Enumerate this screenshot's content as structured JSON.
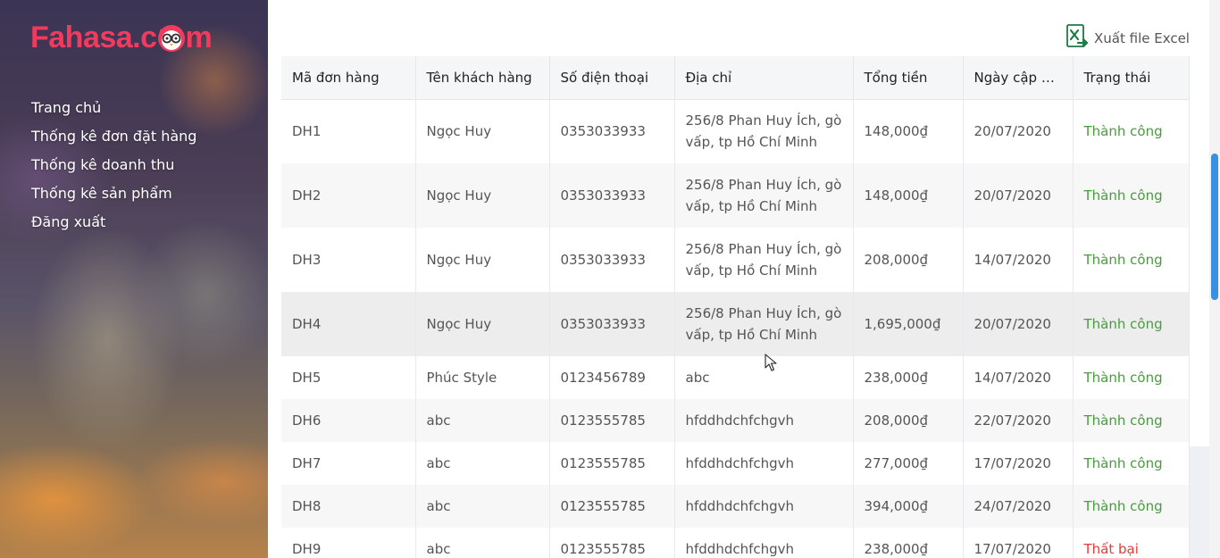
{
  "brand": {
    "logo_pre": "Fahasa.c",
    "logo_post": "m",
    "accent": "#f23a5e"
  },
  "nav": [
    {
      "label": "Trang chủ"
    },
    {
      "label": "Thống kê đơn đặt hàng"
    },
    {
      "label": "Thống kê doanh thu"
    },
    {
      "label": "Thống kê sản phẩm"
    },
    {
      "label": "Đăng xuất"
    }
  ],
  "export": {
    "label": "Xuất file Excel",
    "icon": "excel-icon"
  },
  "table": {
    "headers": [
      "Mã đơn hàng",
      "Tên khách hàng",
      "Số điện thoại",
      "Địa chỉ",
      "Tổng tiền",
      "Ngày cập n...",
      "Trạng thái"
    ],
    "rows": [
      {
        "id": "DH1",
        "name": "Ngọc Huy",
        "phone": "0353033933",
        "address": "256/8 Phan Huy Ích, gò vấp, tp Hồ Chí Minh",
        "total": "148,000₫",
        "date": "20/07/2020",
        "status": "Thành công"
      },
      {
        "id": "DH2",
        "name": "Ngọc Huy",
        "phone": "0353033933",
        "address": "256/8 Phan Huy Ích, gò vấp, tp Hồ Chí Minh",
        "total": "148,000₫",
        "date": "20/07/2020",
        "status": "Thành công"
      },
      {
        "id": "DH3",
        "name": "Ngọc Huy",
        "phone": "0353033933",
        "address": "256/8 Phan Huy Ích, gò vấp, tp Hồ Chí Minh",
        "total": "208,000₫",
        "date": "14/07/2020",
        "status": "Thành công"
      },
      {
        "id": "DH4",
        "name": "Ngọc Huy",
        "phone": "0353033933",
        "address": "256/8 Phan Huy Ích, gò vấp, tp Hồ Chí Minh",
        "total": "1,695,000₫",
        "date": "20/07/2020",
        "status": "Thành công"
      },
      {
        "id": "DH5",
        "name": "Phúc Style",
        "phone": "0123456789",
        "address": "abc",
        "total": "238,000₫",
        "date": "14/07/2020",
        "status": "Thành công"
      },
      {
        "id": "DH6",
        "name": "abc",
        "phone": "0123555785",
        "address": "hfddhdchfchgvh",
        "total": "208,000₫",
        "date": "22/07/2020",
        "status": "Thành công"
      },
      {
        "id": "DH7",
        "name": "abc",
        "phone": "0123555785",
        "address": "hfddhdchfchgvh",
        "total": "277,000₫",
        "date": "17/07/2020",
        "status": "Thành công"
      },
      {
        "id": "DH8",
        "name": "abc",
        "phone": "0123555785",
        "address": "hfddhdchfchgvh",
        "total": "394,000₫",
        "date": "24/07/2020",
        "status": "Thành công"
      },
      {
        "id": "DH9",
        "name": "abc",
        "phone": "0123555785",
        "address": "hfddhdchfchgvh",
        "total": "238,000₫",
        "date": "17/07/2020",
        "status": "Thất bại"
      }
    ]
  },
  "colors": {
    "success": "#4a9b3f",
    "failure": "#e53b3b",
    "scroll_thumb": "#3b8fe0"
  }
}
